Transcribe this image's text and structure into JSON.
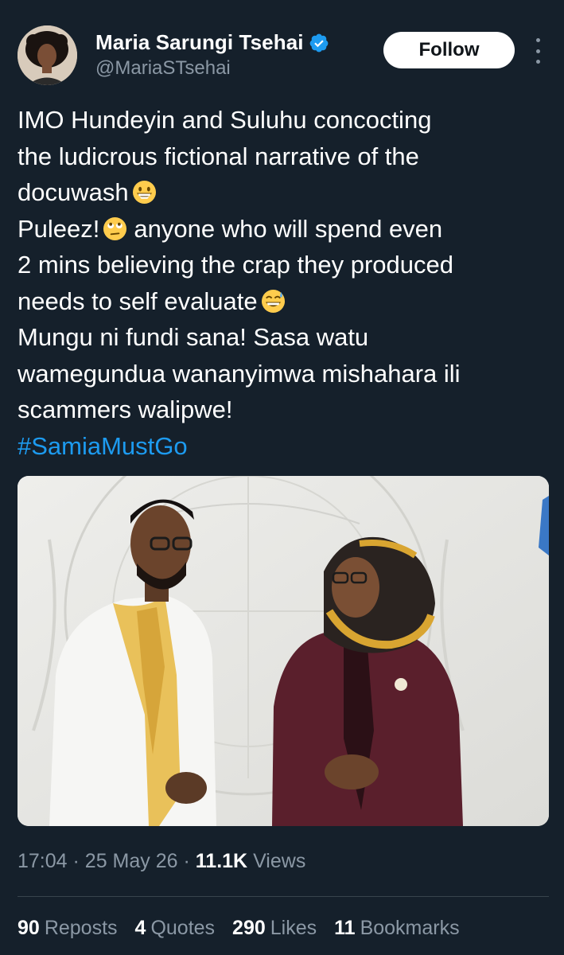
{
  "author": {
    "display_name": "Maria Sarungi Tsehai",
    "handle": "@MariaSTsehai",
    "verified_icon": "verified-badge-icon",
    "avatar_icon": "profile-photo"
  },
  "follow_label": "Follow",
  "tweet": {
    "lines": [
      "IMO Hundeyin and Suluhu concocting",
      "the ludicrous fictional narrative of the",
      "docuwash",
      "Puleez!",
      "anyone who will spend even",
      "2 mins believing the crap they produced",
      "needs to self evaluate",
      "Mungu ni fundi sana! Sasa watu",
      "wamegundua wananyimwa mishahara ili",
      "scammers walipwe!"
    ],
    "hashtag": "#SamiaMustGo",
    "emojis": [
      "grinning-emoji",
      "eye-roll-emoji",
      "sweat-smile-emoji"
    ]
  },
  "meta": {
    "time": "17:04",
    "separator": "·",
    "date": "25 May 26",
    "views_count": "11.1K",
    "views_label": "Views"
  },
  "stats": {
    "reposts": {
      "count": "90",
      "label": "Reposts"
    },
    "quotes": {
      "count": "4",
      "label": "Quotes"
    },
    "likes": {
      "count": "290",
      "label": "Likes"
    },
    "bookmarks": {
      "count": "11",
      "label": "Bookmarks"
    }
  },
  "colors": {
    "background": "#15202b",
    "accent": "#1d9bf0",
    "secondary_text": "#8b98a5",
    "primary_text": "#ffffff"
  }
}
